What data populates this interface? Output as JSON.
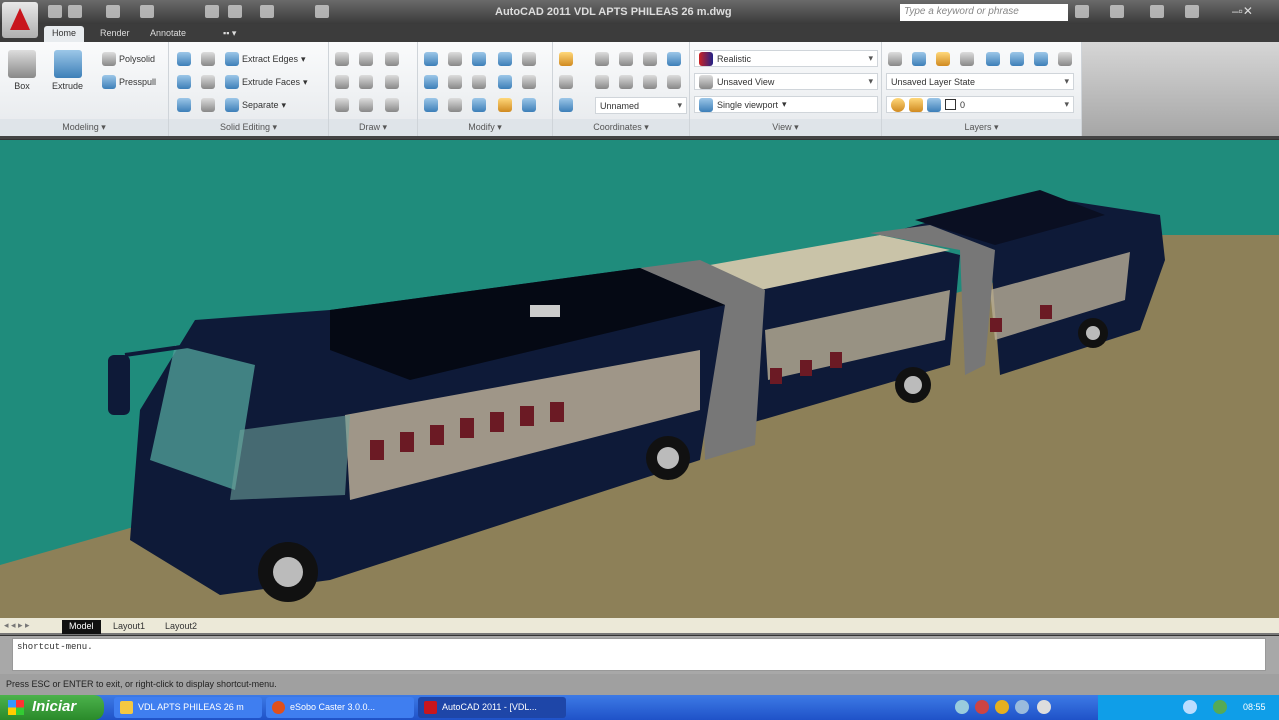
{
  "title_bar": {
    "title": "AutoCAD 2011   VDL APTS PHILEAS 26 m.dwg",
    "search_placeholder": "Type a keyword or phrase"
  },
  "ribbon_tabs": [
    "Home",
    "Render",
    "Annotate"
  ],
  "panels": {
    "modeling": {
      "label": "Modeling",
      "box": "Box",
      "extrude": "Extrude",
      "polysolid": "Polysolid",
      "presspull": "Presspull"
    },
    "solid_editing": {
      "label": "Solid Editing",
      "extract_edges": "Extract Edges",
      "extrude_faces": "Extrude Faces",
      "separate": "Separate"
    },
    "draw": {
      "label": "Draw"
    },
    "modify": {
      "label": "Modify"
    },
    "coordinates": {
      "label": "Coordinates",
      "ucs": "Unnamed"
    },
    "view": {
      "label": "View",
      "visual_style": "Realistic",
      "named_view": "Unsaved View",
      "viewport": "Single viewport"
    },
    "layers": {
      "label": "Layers",
      "layer_state": "Unsaved Layer State",
      "current_layer": "0"
    }
  },
  "layout_tabs": [
    "Model",
    "Layout1",
    "Layout2"
  ],
  "command": {
    "history": "shortcut-menu."
  },
  "status_text": "Press ESC or ENTER to exit, or right-click to display shortcut-menu.",
  "taskbar": {
    "start": "Iniciar",
    "tasks": [
      "VDL APTS PHILEAS 26 m",
      "eSobo Caster 3.0.0...",
      "AutoCAD 2011 - [VDL..."
    ],
    "clock": "08:55"
  },
  "colors": {
    "viewport_bg": "#1f8c7c",
    "ground": "#8d8058",
    "bus_body": "#0e1a38",
    "taskbar": "#245edb"
  }
}
